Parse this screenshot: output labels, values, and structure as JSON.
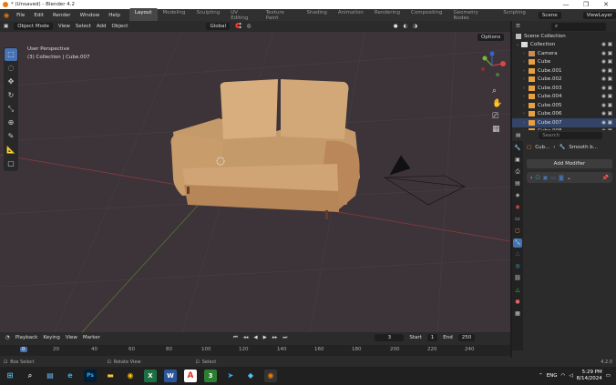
{
  "window": {
    "title": "* (Unsaved) - Blender 4.2",
    "controls": [
      "—",
      "❐",
      "✕"
    ]
  },
  "menus": [
    "File",
    "Edit",
    "Render",
    "Window",
    "Help"
  ],
  "workspaces": [
    "Layout",
    "Modeling",
    "Sculpting",
    "UV Editing",
    "Texture Paint",
    "Shading",
    "Animation",
    "Rendering",
    "Compositing",
    "Geometry Nodes",
    "Scripting"
  ],
  "active_workspace": "Layout",
  "scene": {
    "name": "Scene",
    "view_layer": "ViewLayer"
  },
  "header3d": {
    "mode": "Object Mode",
    "view": "View",
    "select": "Select",
    "add": "Add",
    "object": "Object",
    "transform": "Global",
    "options": "Options"
  },
  "overlay_text": {
    "perspective": "User Perspective",
    "collection": "(3) Collection | Cube.007"
  },
  "outliner": {
    "title": "Scene Collection",
    "search_placeholder": "",
    "items": [
      {
        "label": "Collection",
        "indent": 0,
        "type": "collection"
      },
      {
        "label": "Camera",
        "indent": 1,
        "type": "camera"
      },
      {
        "label": "Cube",
        "indent": 1,
        "type": "mesh"
      },
      {
        "label": "Cube.001",
        "indent": 1,
        "type": "mesh"
      },
      {
        "label": "Cube.002",
        "indent": 1,
        "type": "mesh"
      },
      {
        "label": "Cube.003",
        "indent": 1,
        "type": "mesh"
      },
      {
        "label": "Cube.004",
        "indent": 1,
        "type": "mesh"
      },
      {
        "label": "Cube.005",
        "indent": 1,
        "type": "mesh"
      },
      {
        "label": "Cube.006",
        "indent": 1,
        "type": "mesh"
      },
      {
        "label": "Cube.007",
        "indent": 1,
        "type": "mesh"
      },
      {
        "label": "Cube.008",
        "indent": 1,
        "type": "mesh"
      }
    ]
  },
  "properties": {
    "search_placeholder": "Search",
    "breadcrumb_object": "Cub...",
    "breadcrumb_modifier": "Smooth b...",
    "add_modifier": "Add Modifier"
  },
  "timeline": {
    "playback": "Playback",
    "keying": "Keying",
    "view": "View",
    "marker": "Marker",
    "current_frame": "3",
    "start_label": "Start",
    "start": "1",
    "end_label": "End",
    "end": "250",
    "ticks": [
      "0",
      "20",
      "40",
      "60",
      "80",
      "100",
      "120",
      "140",
      "160",
      "180",
      "200",
      "220",
      "240"
    ]
  },
  "status": {
    "left": "Box Select",
    "mid": "Rotate View",
    "right": "Select",
    "version": "4.2.0"
  },
  "taskbar": {
    "apps": [
      "Ps",
      "X",
      "W",
      "A",
      "3"
    ],
    "tray_lang": "ENG",
    "time": "5:29 PM",
    "date": "8/14/2024"
  }
}
